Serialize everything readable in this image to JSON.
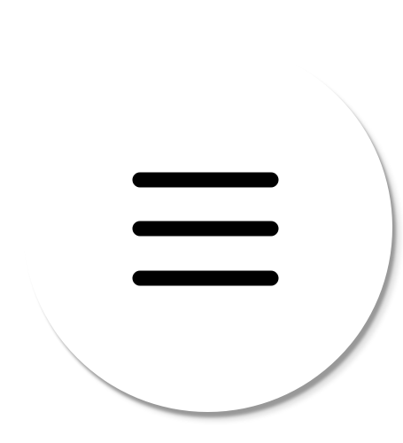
{
  "menu_button": {
    "icon": "hamburger-menu-icon",
    "background_color": "#ffffff",
    "icon_color": "#000000"
  }
}
